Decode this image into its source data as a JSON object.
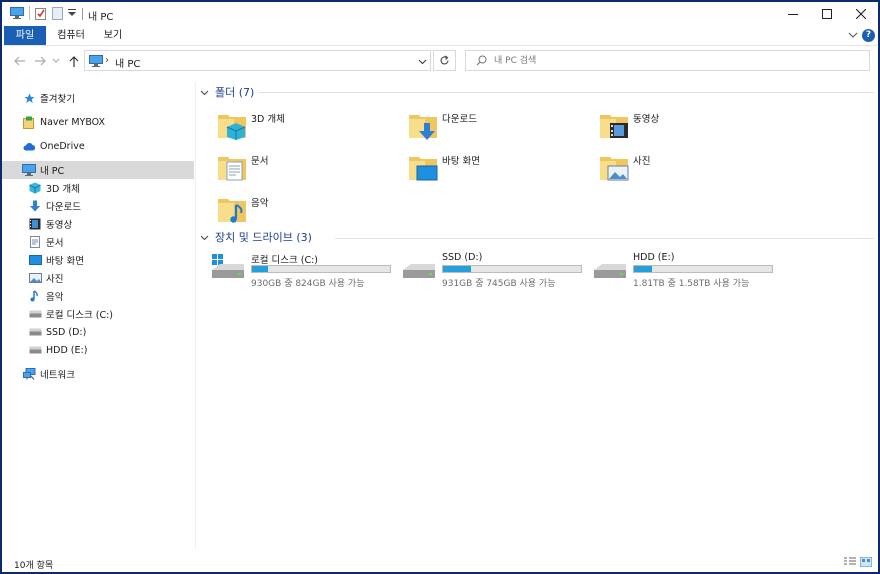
{
  "window": {
    "title": "내 PC"
  },
  "ribbon": {
    "tabs": [
      "파일",
      "컴퓨터",
      "보기"
    ]
  },
  "address": {
    "path": "내 PC"
  },
  "search": {
    "placeholder": "내 PC 검색"
  },
  "nav_pane": {
    "items": [
      {
        "label": "즐겨찾기",
        "icon": "star-icon"
      },
      {
        "label": "Naver MYBOX",
        "icon": "mybox-icon"
      },
      {
        "label": "OneDrive",
        "icon": "cloud-icon"
      },
      {
        "label": "내 PC",
        "icon": "computer-icon",
        "selected": true
      },
      {
        "label": "3D 개체",
        "icon": "cube-icon"
      },
      {
        "label": "다운로드",
        "icon": "download-icon"
      },
      {
        "label": "동영상",
        "icon": "video-icon"
      },
      {
        "label": "문서",
        "icon": "document-icon"
      },
      {
        "label": "바탕 화면",
        "icon": "desktop-icon"
      },
      {
        "label": "사진",
        "icon": "picture-icon"
      },
      {
        "label": "음악",
        "icon": "music-icon"
      },
      {
        "label": "로컬 디스크 (C:)",
        "icon": "drive-icon"
      },
      {
        "label": "SSD (D:)",
        "icon": "drive-icon"
      },
      {
        "label": "HDD (E:)",
        "icon": "drive-icon"
      },
      {
        "label": "네트워크",
        "icon": "network-icon"
      }
    ]
  },
  "folders": {
    "header": "폴더 (7)",
    "items": [
      {
        "label": "3D 개체",
        "icon": "cube-folder-icon"
      },
      {
        "label": "다운로드",
        "icon": "download-folder-icon"
      },
      {
        "label": "동영상",
        "icon": "video-folder-icon"
      },
      {
        "label": "문서",
        "icon": "document-folder-icon"
      },
      {
        "label": "바탕 화면",
        "icon": "desktop-folder-icon"
      },
      {
        "label": "사진",
        "icon": "picture-folder-icon"
      },
      {
        "label": "음악",
        "icon": "music-folder-icon"
      }
    ]
  },
  "drives": {
    "header": "장치 및 드라이브 (3)",
    "items": [
      {
        "name": "로컬 디스크 (C:)",
        "free_text": "930GB 중 824GB 사용 가능",
        "used_fraction": 0.114
      },
      {
        "name": "SSD (D:)",
        "free_text": "931GB 중 745GB 사용 가능",
        "used_fraction": 0.2
      },
      {
        "name": "HDD (E:)",
        "free_text": "1.81TB 중 1.58TB 사용 가능",
        "used_fraction": 0.127
      }
    ]
  },
  "status": {
    "count": "10개 항목"
  },
  "colors": {
    "accent": "#1a5fb4",
    "header": "#1e3d8f",
    "progress": "#26a0da",
    "folder": "#f0c75e"
  }
}
